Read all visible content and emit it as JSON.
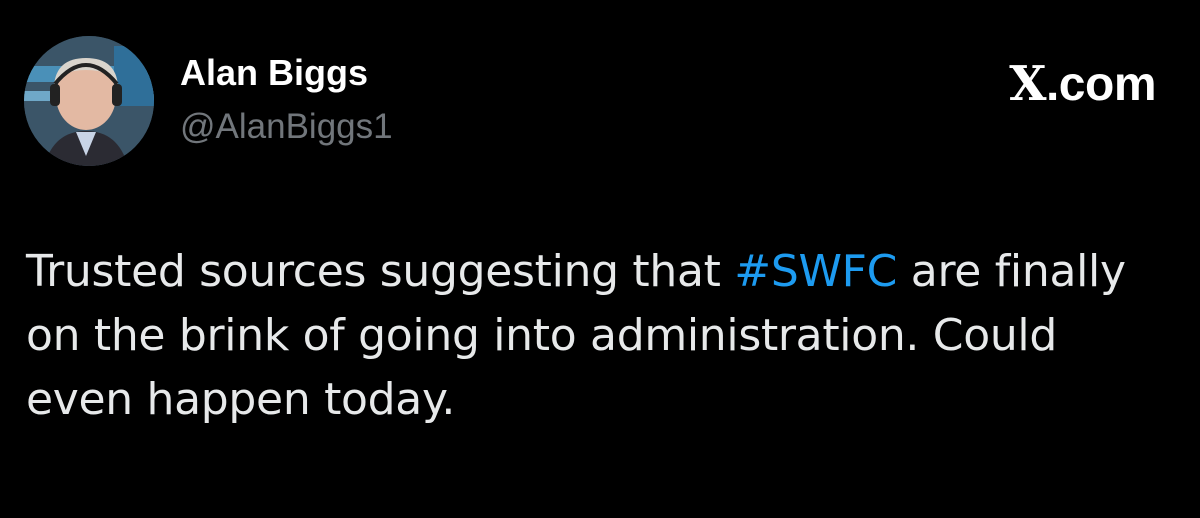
{
  "author": {
    "display_name": "Alan Biggs",
    "handle": "@AlanBiggs1",
    "avatar_icon": "profile-photo"
  },
  "header": {
    "site_logo_glyph": "X",
    "site_logo_suffix": ".com"
  },
  "tweet": {
    "text_before": "Trusted sources suggesting that ",
    "hashtag": "#SWFC",
    "text_after": " are finally on the brink of going into administration. Could even happen today."
  },
  "colors": {
    "background": "#000000",
    "primary_text": "#e7e9ea",
    "secondary_text": "#71767b",
    "hashtag": "#1d9bf0"
  }
}
